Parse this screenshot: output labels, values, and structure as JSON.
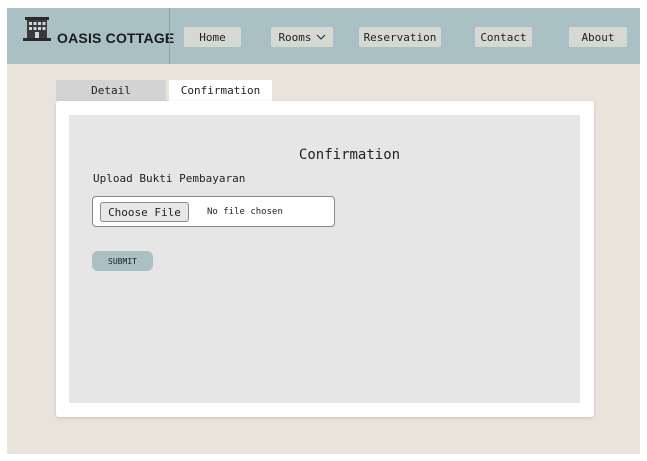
{
  "brand": {
    "name": "OASIS COTTAGE",
    "logo_icon": "building-icon"
  },
  "nav": {
    "home": "Home",
    "rooms": "Rooms",
    "rooms_icon": "chevron-down-icon",
    "reservation": "Reservation",
    "contact": "Contact",
    "about": "About"
  },
  "tabs": {
    "detail": "Detail",
    "confirmation": "Confirmation",
    "active": "Confirmation"
  },
  "form": {
    "title": "Confirmation",
    "upload_label": "Upload Bukti Pembayaran",
    "choose_file_label": "Choose File",
    "file_status": "No file chosen",
    "submit_label": "SUBMIT"
  },
  "colors": {
    "header_bg": "#a9c1c4",
    "page_bg": "#e8e4dc",
    "submit_bg": "#a9c1c4",
    "form_bg": "#e6e6e6"
  }
}
